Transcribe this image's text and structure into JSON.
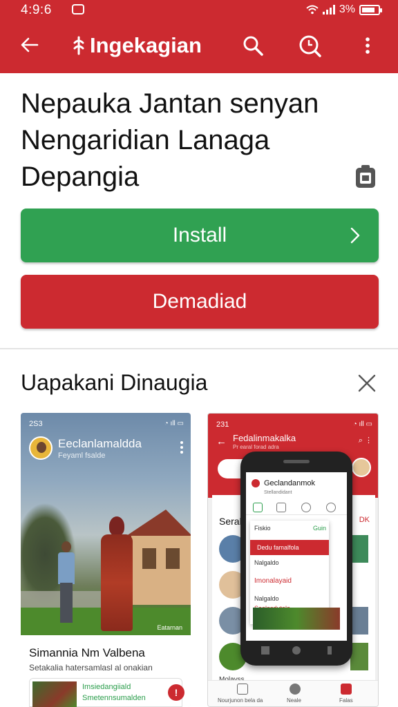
{
  "status_bar": {
    "time": "4:9:6",
    "battery": "3%"
  },
  "app_bar": {
    "title": "Ingekagian",
    "icons": [
      "back-arrow-icon",
      "search-icon",
      "search-zoom-icon",
      "more-vert-icon"
    ]
  },
  "headline": "Nepauka Jantan senyan Nengaridian Lanaga Depangia",
  "buttons": {
    "install": "Install",
    "demo": "Demadiad"
  },
  "section": {
    "title": "Uapakani Dinaugia"
  },
  "screenshot1": {
    "status_time": "2S3",
    "profile_name": "Eeclanlamaldda",
    "profile_sub": "Feyaml fsalde",
    "caption": "Eatarnan",
    "info_title": "Simannia Nm Valbena",
    "info_sub": "Setakalia hatersamlasl al onakian",
    "mini_line1": "Imsiedangiiald",
    "mini_line2": "Smetennsumalden",
    "alert": "!"
  },
  "screenshot2": {
    "status_time": "231",
    "title": "Fedalinmakalka",
    "subtitle": "Pr earal forad adra",
    "section": "Seral",
    "section_right": "DK",
    "nav_left": "Nourjunon bela da",
    "nav_mid": "Neale",
    "nav_right": "Falas",
    "bottom_label": "Molayss"
  },
  "phone": {
    "title": "Geclandanmok",
    "subtitle": "Stellandidant",
    "menu_item1": "Fiskio",
    "menu_item1_right": "Guin",
    "menu_item2": "Dedu famalfola",
    "menu_item3": "Nalgaldo",
    "menu_item4": "Imonalayaid",
    "menu_item5": "Nalgaldo",
    "menu_item6": "Saelasdutalo"
  },
  "colors": {
    "brand_red": "#cc2a30",
    "install_green": "#30a152"
  }
}
